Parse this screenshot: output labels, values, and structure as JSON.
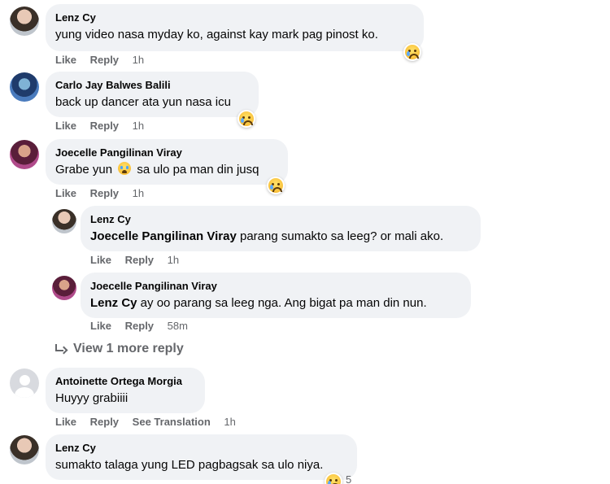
{
  "comments": [
    {
      "author": "Lenz Cy",
      "text": "yung video nasa myday ko, against kay mark pag pinost ko.",
      "actions": {
        "like": "Like",
        "reply": "Reply",
        "time": "1h"
      }
    },
    {
      "author": "Carlo Jay Balwes Balili",
      "text": "back up dancer ata yun nasa icu",
      "actions": {
        "like": "Like",
        "reply": "Reply",
        "time": "1h"
      }
    },
    {
      "author": "Joecelle Pangilinan Viray",
      "text_before": "Grabe yun",
      "text_after": "sa ulo pa man din jusq",
      "actions": {
        "like": "Like",
        "reply": "Reply",
        "time": "1h"
      }
    }
  ],
  "replies": [
    {
      "author": "Lenz Cy",
      "tag": "Joecelle Pangilinan Viray",
      "text": " parang sumakto sa leeg? or mali ako.",
      "actions": {
        "like": "Like",
        "reply": "Reply",
        "time": "1h"
      }
    },
    {
      "author": "Joecelle Pangilinan Viray",
      "tag": "Lenz Cy",
      "text": " ay oo parang sa leeg nga. Ang bigat pa man din nun.",
      "actions": {
        "like": "Like",
        "reply": "Reply",
        "time": "58m"
      }
    }
  ],
  "view_more": "View 1 more reply",
  "comments2": [
    {
      "author": "Antoinette Ortega Morgia",
      "text": "Huyyy grabiiii",
      "actions": {
        "like": "Like",
        "reply": "Reply",
        "translate": "See Translation",
        "time": "1h"
      }
    },
    {
      "author": "Lenz Cy",
      "text": "sumakto talaga yung LED pagbagsak sa ulo niya.",
      "reaction_count": "5"
    }
  ],
  "icons": {
    "reaction": "sad-face-icon",
    "reply_arrow": "reply-arrow-icon"
  }
}
